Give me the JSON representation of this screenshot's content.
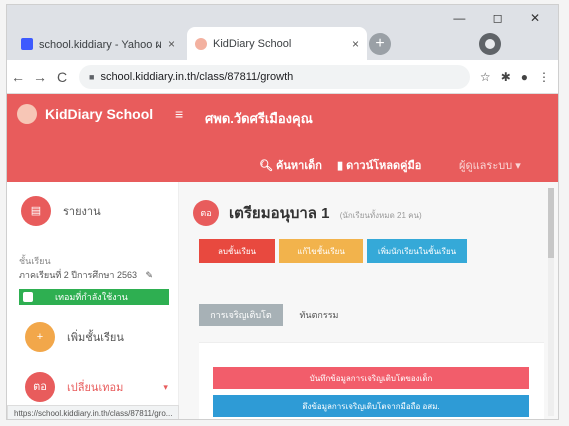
{
  "browser": {
    "tabs": [
      {
        "title": "school.kiddiary - Yahoo ผลลัพธ์",
        "favicon_color": "#3d5afe"
      },
      {
        "title": "KidDiary School",
        "favicon_color": "#f3b1a0"
      }
    ],
    "tab_close": "×",
    "new_tab": "+",
    "window_controls": "— ◻ ✕",
    "back": "←",
    "forward": "→",
    "reload": "C",
    "url": "school.kiddiary.in.th/class/87811/growth",
    "status_url": "https://school.kiddiary.in.th/class/87811/gro..."
  },
  "header": {
    "brand": "KidDiary School",
    "menu_icon": "≡",
    "school_name": "ศพด.วัดศรีเมืองคุณ",
    "search_label": "ค้นหาเด็ก",
    "manual_label": "ดาวน์โหลดคู่มือ",
    "user_label": "ผู้ดูแลระบบ"
  },
  "sidebar": {
    "report_label": "รายงาน",
    "level_label": "ชั้นเรียน",
    "term_label": "ภาคเรียนที่ 2 ปีการศึกษา 2563",
    "badge_label": "เทอมที่กำลังใช้งาน",
    "add_class_label": "เพิ่มชั้นเรียน",
    "third_label": "เปลี่ยนเทอม"
  },
  "main": {
    "room_initials": "ตอ",
    "room_title": "เตรียมอนุบาล 1",
    "room_sub": "(นักเรียนทั้งหมด 21 คน)",
    "actions": [
      "ลบชั้นเรียน",
      "แก้ไขชั้นเรียน",
      "เพิ่มนักเรียนในชั้นเรียน"
    ],
    "tabs": [
      "การเจริญเติบโต",
      "ทันตกรรม"
    ],
    "panel_buttons": [
      "บันทึกข้อมูลการเจริญเติบโตของเด็ก",
      "ดึงข้อมูลการเจริญเติบโตจากมือถือ อสม."
    ]
  },
  "colors": {
    "brand_red": "#e85c5c",
    "active_green": "#2eaf51",
    "action_blue": "#35a9d8"
  }
}
